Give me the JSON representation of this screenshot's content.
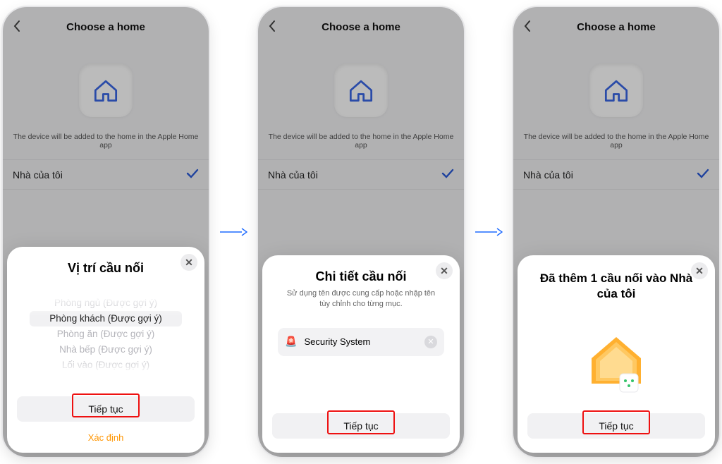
{
  "bg": {
    "title": "Choose a home",
    "caption": "The device will be added to the home in the Apple Home app",
    "selected_home": "Nhà của tôi"
  },
  "sheet1": {
    "title": "Vị trí cầu nối",
    "options": [
      "Phòng ngủ (Được gợi ý)",
      "Phòng khách (Được gợi ý)",
      "Phòng ăn (Được gợi ý)",
      "Nhà bếp (Được gợi ý)",
      "Lối vào (Được gợi ý)"
    ],
    "selected_index": 1,
    "cta": "Tiếp tục",
    "link": "Xác định"
  },
  "sheet2": {
    "title": "Chi tiết cầu nối",
    "subtitle": "Sử dụng tên được cung cấp hoặc nhập tên tùy chỉnh cho từng mục.",
    "field_value": "Security System",
    "cta": "Tiếp tục"
  },
  "sheet3": {
    "title": "Đã thêm 1 cầu nối vào Nhà của tôi",
    "cta": "Tiếp tục"
  }
}
